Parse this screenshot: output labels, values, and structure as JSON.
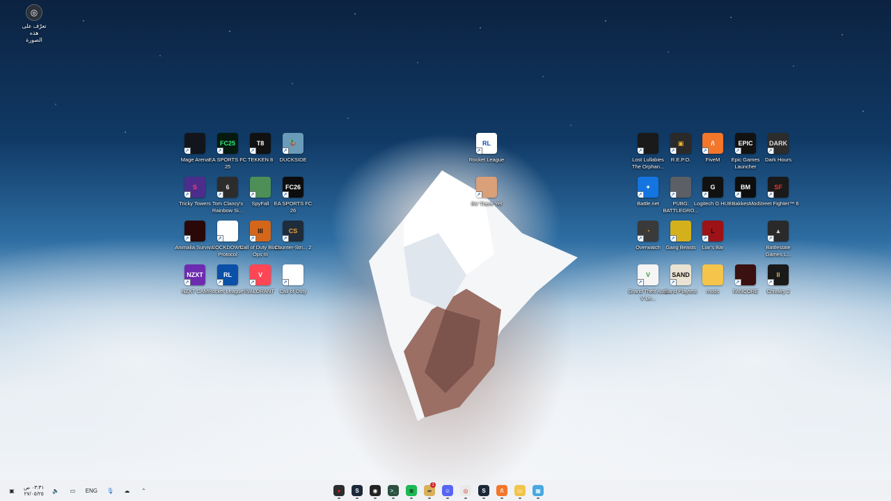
{
  "recognize_image": {
    "icon": "lens-icon",
    "text": "تعرّف على\nهذه الصورة"
  },
  "desktop_icons": [
    {
      "name": "mage-arena",
      "label": "Mage Arena",
      "glyph": "",
      "bg": "#12161c",
      "fg": "#fff"
    },
    {
      "name": "ea-sports-fc-25",
      "label": "EA SPORTS FC 25",
      "glyph": "FC25",
      "bg": "#061a10",
      "fg": "#2cf27a"
    },
    {
      "name": "tekken-8",
      "label": "TEKKEN 8",
      "glyph": "T8",
      "bg": "#111",
      "fg": "#fff"
    },
    {
      "name": "duckside",
      "label": "DUCKSIDE",
      "glyph": "🦆",
      "bg": "#6a9bb8",
      "fg": "#fff"
    },
    {
      "name": "tricky-towers",
      "label": "Tricky Towers",
      "glyph": "S",
      "bg": "#4c2d8b",
      "fg": "#ff3b73"
    },
    {
      "name": "rainbow-six",
      "label": "Tom Clancy's Rainbow Si...",
      "glyph": "6",
      "bg": "#2c2c2c",
      "fg": "#e5e5e5"
    },
    {
      "name": "spyfall",
      "label": "SpyFall",
      "glyph": "",
      "bg": "#4e8f57",
      "fg": "#fff"
    },
    {
      "name": "ea-sports-fc-26",
      "label": "EA SPORTS FC 26",
      "glyph": "FC26",
      "bg": "#0c0c0c",
      "fg": "#fff"
    },
    {
      "name": "animalia-survival",
      "label": "Animalia Survival",
      "glyph": "",
      "bg": "#2a0808",
      "fg": "#fff"
    },
    {
      "name": "lockdown-protocol",
      "label": "LOCKDOWN Protocol",
      "glyph": "",
      "bg": "#ffffff",
      "fg": "#c00"
    },
    {
      "name": "call-of-duty-bo3",
      "label": "Call of Duty Black Ops III",
      "glyph": "III",
      "bg": "#d4661a",
      "fg": "#111"
    },
    {
      "name": "counter-strike-2",
      "label": "Counter-Stri... 2",
      "glyph": "CS",
      "bg": "#1f2c3a",
      "fg": "#f0a033"
    },
    {
      "name": "nzxt-cam",
      "label": "NZXT CAM",
      "glyph": "NZXT",
      "bg": "#6d2bb0",
      "fg": "#fff"
    },
    {
      "name": "rocket-league-2",
      "label": "Rocket League®",
      "glyph": "RL",
      "bg": "#0a4fa8",
      "fg": "#fff"
    },
    {
      "name": "valorant",
      "label": "VALORANT",
      "glyph": "V",
      "bg": "#ff4655",
      "fg": "#fff"
    },
    {
      "name": "call-of-duty",
      "label": "Call of Duty",
      "glyph": "",
      "bg": "#ffffff",
      "fg": "#888"
    },
    {
      "name": "rocket-league",
      "label": "Rocket League",
      "glyph": "RL",
      "bg": "#ffffff",
      "fg": "#0a4fa8"
    },
    {
      "name": "rv-there-yet",
      "label": "RV There Yet",
      "glyph": "",
      "bg": "#d9a07a",
      "fg": "#fff"
    },
    {
      "name": "lost-lullabies",
      "label": "Lost Lullabies The Orphan...",
      "glyph": "",
      "bg": "#1a1a1a",
      "fg": "#ccc"
    },
    {
      "name": "repo",
      "label": "R.E.P.O.",
      "glyph": "▣",
      "bg": "#2a2a2a",
      "fg": "#f2b824"
    },
    {
      "name": "fivem",
      "label": "FiveM",
      "glyph": "/\\",
      "bg": "#f3762a",
      "fg": "#fff"
    },
    {
      "name": "epic-games-launcher",
      "label": "Epic Games Launcher",
      "glyph": "EPIC",
      "bg": "#121212",
      "fg": "#fff"
    },
    {
      "name": "dark-hours",
      "label": "Dark Hours",
      "glyph": "DARK",
      "bg": "#2c2c2c",
      "fg": "#ddd"
    },
    {
      "name": "battle-net",
      "label": "Battle.net",
      "glyph": "✦",
      "bg": "#1475e1",
      "fg": "#fff"
    },
    {
      "name": "pubg",
      "label": "PUBG: BATTLEGRO...",
      "glyph": "",
      "bg": "#5c5f66",
      "fg": "#fff"
    },
    {
      "name": "logitech-g-hub",
      "label": "Logitech G HUB",
      "glyph": "G",
      "bg": "#111",
      "fg": "#fff"
    },
    {
      "name": "bakkesmod",
      "label": "BakkesMod",
      "glyph": "BM",
      "bg": "#0d0d0d",
      "fg": "#fff"
    },
    {
      "name": "street-fighter-6",
      "label": "Street Fighter™ 6",
      "glyph": "SF",
      "bg": "#1a1a1a",
      "fg": "#e33"
    },
    {
      "name": "overwatch",
      "label": "Overwatch",
      "glyph": "◔",
      "bg": "#3a3a3a",
      "fg": "#f99e1a"
    },
    {
      "name": "gang-beasts",
      "label": "Gang Beasts",
      "glyph": "",
      "bg": "#d4b11c",
      "fg": "#222"
    },
    {
      "name": "liars-bar",
      "label": "Liar's Bar",
      "glyph": "L",
      "bg": "#9c1216",
      "fg": "#111"
    },
    {
      "name": "battlestate-games",
      "label": "Battlestate Games L...",
      "glyph": "▲",
      "bg": "#2a2a2a",
      "fg": "#ccc"
    },
    {
      "name": "gta-v",
      "label": "Grand Theft Auto V Le...",
      "glyph": "V",
      "bg": "#f5f5f5",
      "fg": "#3a9a3a"
    },
    {
      "name": "sand-playtest",
      "label": "Sand Playtest",
      "glyph": "SAND",
      "bg": "#eae2d2",
      "fg": "#111"
    },
    {
      "name": "mods",
      "label": "mods",
      "glyph": "",
      "bg": "#f4c54a",
      "fg": "#fff"
    },
    {
      "name": "fancore",
      "label": "FANCORE",
      "glyph": "",
      "bg": "#3a1010",
      "fg": "#fff"
    },
    {
      "name": "chivalry-2",
      "label": "Chivalry 2",
      "glyph": "II",
      "bg": "#1a1a1a",
      "fg": "#d8b25a"
    }
  ],
  "taskbar": {
    "clock_time": "٠٣:٣١ ص",
    "clock_date": "٢٧/٠٥/٢٥",
    "language": "ENG",
    "tray_icons": [
      "notification-icon",
      "volume-icon",
      "network-icon",
      "cloud-icon",
      "chevron-up-icon"
    ],
    "apps": [
      {
        "name": "nvidia-app",
        "glyph": "●",
        "bg": "#2d2d2d",
        "fg": "#e02020",
        "badge": ""
      },
      {
        "name": "steam",
        "glyph": "S",
        "bg": "#1b2838",
        "fg": "#fff",
        "badge": ""
      },
      {
        "name": "lockdown-app",
        "glyph": "◉",
        "bg": "#222",
        "fg": "#fff",
        "badge": ""
      },
      {
        "name": "terminal",
        "glyph": ">_",
        "bg": "#2f4f3f",
        "fg": "#9ef",
        "badge": ""
      },
      {
        "name": "spotify",
        "glyph": "≋",
        "bg": "#1db954",
        "fg": "#111",
        "badge": ""
      },
      {
        "name": "goggles-app",
        "glyph": "∞",
        "bg": "#d8b15a",
        "fg": "#222",
        "badge": "1"
      },
      {
        "name": "discord",
        "glyph": "☺",
        "bg": "#5865f2",
        "fg": "#fff",
        "badge": ""
      },
      {
        "name": "chrome",
        "glyph": "◎",
        "bg": "#e9e9e9",
        "fg": "#d93025",
        "badge": ""
      },
      {
        "name": "steam-2",
        "glyph": "S",
        "bg": "#1b2838",
        "fg": "#fff",
        "badge": ""
      },
      {
        "name": "fivem-app",
        "glyph": "/\\",
        "bg": "#f3762a",
        "fg": "#fff",
        "badge": ""
      },
      {
        "name": "file-explorer",
        "glyph": "▭",
        "bg": "#f3c44a",
        "fg": "#fff",
        "badge": ""
      },
      {
        "name": "windows-store",
        "glyph": "▦",
        "bg": "#47a9e0",
        "fg": "#fff",
        "badge": ""
      }
    ]
  }
}
